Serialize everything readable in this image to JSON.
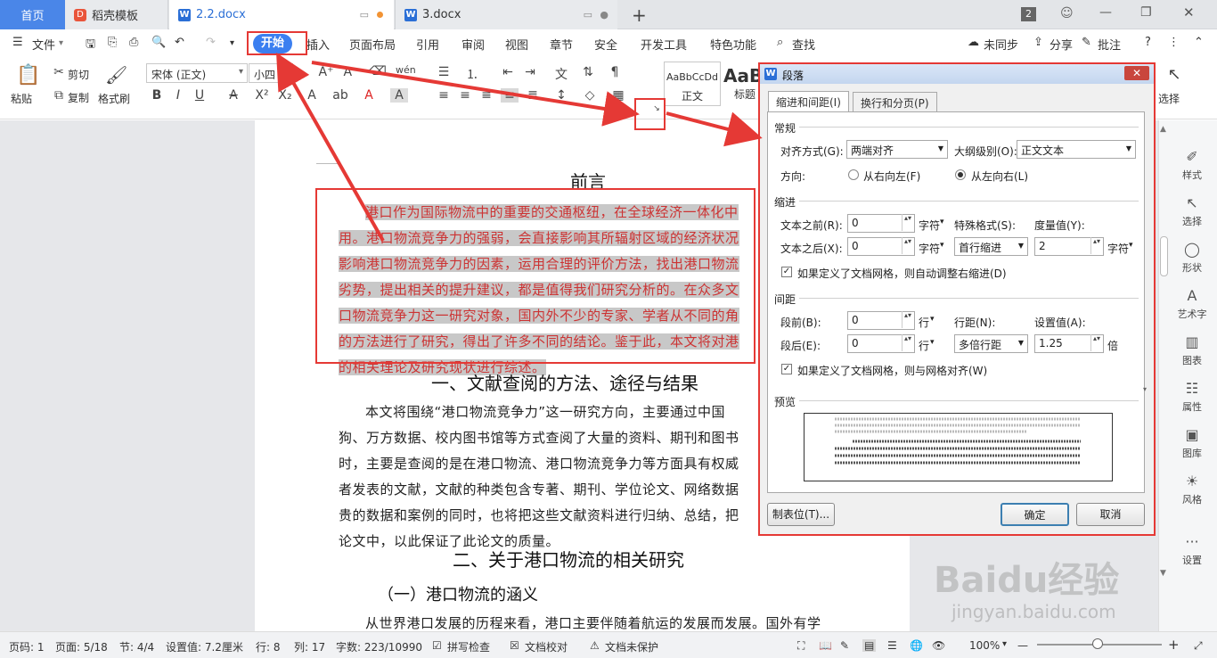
{
  "tabs": {
    "home": "首页",
    "template": "稻壳模板",
    "doc1": "2.2.docx",
    "doc2": "3.docx",
    "badge": "2"
  },
  "menu": {
    "file": "文件",
    "start": "开始",
    "insert": "插入",
    "layout": "页面布局",
    "reference": "引用",
    "review": "审阅",
    "view": "视图",
    "chapter": "章节",
    "security": "安全",
    "dev": "开发工具",
    "special": "特色功能",
    "search": "查找",
    "sync": "未同步",
    "share": "分享",
    "comment": "批注"
  },
  "ribbon": {
    "paste": "粘贴",
    "cut": "剪切",
    "copy": "复制",
    "format_painter": "格式刷",
    "font_name": "宋体 (正文)",
    "font_size": "小四",
    "style1_preview": "AaBbCcDd",
    "style1": "正文",
    "style2_preview": "AaB",
    "style2": "标题",
    "select": "选择"
  },
  "document": {
    "heading_preface": "前言",
    "preface_lines": [
      "港口作为国际物流中的重要的交通枢纽，在全球经济一体化中",
      "用。港口物流竞争力的强弱，会直接影响其所辐射区域的经济状况",
      "影响港口物流竞争力的因素，运用合理的评价方法，找出港口物流",
      "劣势，提出相关的提升建议，都是值得我们研究分析的。在众多文",
      "口物流竞争力这一研究对象，国内外不少的专家、学者从不同的角",
      "的方法进行了研究，得出了许多不同的结论。鉴于此，本文将对港",
      "的相关理论及研究现状进行综述。"
    ],
    "heading1": "一、文献查阅的方法、途径与结果",
    "section1_lines": [
      "本文将围绕“港口物流竞争力”这一研究方向，主要通过中国",
      "狗、万方数据、校内图书馆等方式查阅了大量的资料、期刊和图书",
      "时，主要是查阅的是在港口物流、港口物流竞争力等方面具有权威",
      "者发表的文献，文献的种类包含专著、期刊、学位论文、网络数据",
      "贵的数据和案例的同时，也将把这些文献资料进行归纳、总结，把",
      "论文中，以此保证了此论文的质量。"
    ],
    "heading2": "二、关于港口物流的相关研究",
    "heading3": "（一）港口物流的涵义",
    "last_line": "从世界港口发展的历程来看，港口主要伴随着航运的发展而发展。国外有学"
  },
  "sidebar": {
    "style": "样式",
    "select": "选择",
    "shape": "形状",
    "art": "艺术字",
    "chart": "图表",
    "property": "属性",
    "gallery": "图库",
    "theme": "风格",
    "settings": "设置"
  },
  "status": {
    "page_no": "页码: 1",
    "pages": "页面: 5/18",
    "section": "节: 4/4",
    "setting": "设置值: 7.2厘米",
    "row": "行: 8",
    "col": "列: 17",
    "words": "字数: 223/10990",
    "spell": "拼写检查",
    "proof": "文档校对",
    "protect": "文档未保护",
    "zoom": "100%"
  },
  "dialog": {
    "title": "段落",
    "tab1": "缩进和间距(I)",
    "tab2": "换行和分页(P)",
    "general": "常规",
    "align_label": "对齐方式(G):",
    "align_value": "两端对齐",
    "outline_label": "大纲级别(O):",
    "outline_value": "正文文本",
    "direction_label": "方向:",
    "rtl": "从右向左(F)",
    "ltr": "从左向右(L)",
    "indent": "缩进",
    "before_text_label": "文本之前(R):",
    "before_text_value": "0",
    "after_text_label": "文本之后(X):",
    "after_text_value": "0",
    "unit_char": "字符",
    "special_label": "特殊格式(S):",
    "special_value": "首行缩进",
    "measure_label": "度量值(Y):",
    "measure_value": "2",
    "auto_indent": "如果定义了文档网格，则自动调整右缩进(D)",
    "spacing": "间距",
    "before_label": "段前(B):",
    "before_value": "0",
    "after_label": "段后(E):",
    "after_value": "0",
    "unit_line": "行",
    "line_label": "行距(N):",
    "line_value": "多倍行距",
    "set_label": "设置值(A):",
    "set_value": "1.25",
    "times": "倍",
    "grid_align": "如果定义了文档网格，则与网格对齐(W)",
    "preview": "预览",
    "tabs_button": "制表位(T)...",
    "ok": "确定",
    "cancel": "取消"
  },
  "watermark": {
    "brand": "Baidu经验",
    "url": "jingyan.baidu.com"
  }
}
